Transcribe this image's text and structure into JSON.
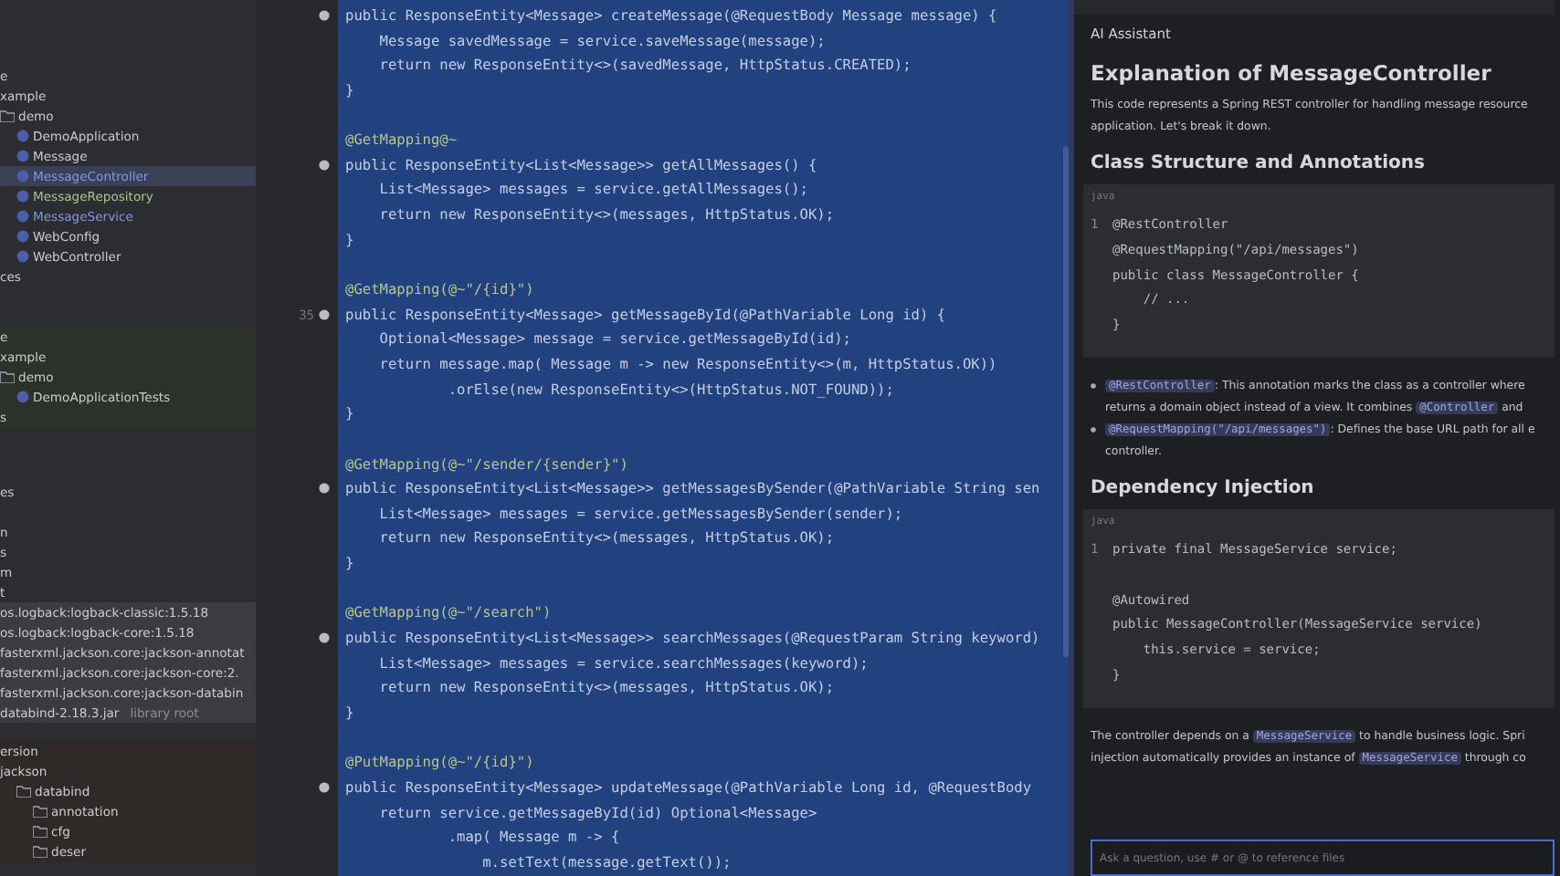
{
  "project_tree": {
    "sections": [
      {
        "kind": "main",
        "items": [
          {
            "label": "e"
          },
          {
            "label": "xample"
          },
          {
            "label": "demo",
            "kind": "folder",
            "children": [
              {
                "label": "DemoApplication",
                "kind": "class",
                "selected": false
              },
              {
                "label": "Message",
                "kind": "class",
                "selected": false
              },
              {
                "label": "MessageController",
                "kind": "class",
                "selected": true,
                "color": "#7f97e6"
              },
              {
                "label": "MessageRepository",
                "kind": "class",
                "selected": false,
                "color": "#a9c48f"
              },
              {
                "label": "MessageService",
                "kind": "class",
                "selected": false,
                "color": "#7f97e6"
              },
              {
                "label": "WebConfig",
                "kind": "class",
                "selected": false
              },
              {
                "label": "WebController",
                "kind": "class",
                "selected": false
              }
            ]
          },
          {
            "label": "ces"
          }
        ]
      },
      {
        "kind": "test",
        "items": [
          {
            "label": "e"
          },
          {
            "label": "xample"
          },
          {
            "label": "demo",
            "kind": "folder",
            "children": [
              {
                "label": "DemoApplicationTests",
                "kind": "class",
                "selected": false
              }
            ]
          },
          {
            "label": "s"
          }
        ]
      },
      {
        "kind": "other",
        "items": [
          {
            "label": "es"
          }
        ]
      },
      {
        "kind": "other",
        "items": [
          {
            "label": "n"
          },
          {
            "label": "s"
          },
          {
            "label": "m"
          },
          {
            "label": "t"
          }
        ]
      },
      {
        "kind": "libraries",
        "items": [
          {
            "label": "os.logback:logback-classic:1.5.18"
          },
          {
            "label": "os.logback:logback-core:1.5.18"
          },
          {
            "label": "fasterxml.jackson.core:jackson-annotat"
          },
          {
            "label": "fasterxml.jackson.core:jackson-core:2."
          },
          {
            "label": "fasterxml.jackson.core:jackson-databin"
          },
          {
            "label": "databind-2.18.3.jar",
            "hint": "library root"
          }
        ]
      },
      {
        "kind": "external",
        "items": [
          {
            "label": "ersion"
          },
          {
            "label": "jackson",
            "children": [
              {
                "label": "databind",
                "kind": "folder",
                "children": [
                  {
                    "label": "annotation",
                    "kind": "folder"
                  },
                  {
                    "label": "cfg",
                    "kind": "folder"
                  },
                  {
                    "label": "deser",
                    "kind": "folder"
                  }
                ]
              }
            ]
          }
        ]
      }
    ]
  },
  "gutter": {
    "line_number": "35"
  },
  "editor": {
    "lines": [
      {
        "kind": "code",
        "text": "public ResponseEntity<Message> createMessage(@RequestBody Message message) {",
        "bean": true
      },
      {
        "kind": "code",
        "text": "    Message savedMessage = service.saveMessage(message);"
      },
      {
        "kind": "code",
        "text": "    return new ResponseEntity<>(savedMessage, HttpStatus.CREATED);"
      },
      {
        "kind": "code",
        "text": "}"
      },
      {
        "kind": "blank"
      },
      {
        "kind": "annotation",
        "text": "@GetMapping@~"
      },
      {
        "kind": "code",
        "text": "public ResponseEntity<List<Message>> getAllMessages() {",
        "bean": true
      },
      {
        "kind": "code",
        "text": "    List<Message> messages = service.getAllMessages();"
      },
      {
        "kind": "code",
        "text": "    return new ResponseEntity<>(messages, HttpStatus.OK);"
      },
      {
        "kind": "code",
        "text": "}"
      },
      {
        "kind": "blank"
      },
      {
        "kind": "annotation",
        "text": "@GetMapping(@~\"/{id}\")"
      },
      {
        "kind": "code",
        "text": "public ResponseEntity<Message> getMessageById(@PathVariable Long id) {",
        "bean": true,
        "numbered": true
      },
      {
        "kind": "code",
        "text": "    Optional<Message> message = service.getMessageById(id);"
      },
      {
        "kind": "code",
        "text": "    return message.map( Message m -> new ResponseEntity<>(m, HttpStatus.OK))"
      },
      {
        "kind": "code",
        "text": "            .orElse(new ResponseEntity<>(HttpStatus.NOT_FOUND));"
      },
      {
        "kind": "code",
        "text": "}"
      },
      {
        "kind": "blank"
      },
      {
        "kind": "annotation",
        "text": "@GetMapping(@~\"/sender/{sender}\")"
      },
      {
        "kind": "code",
        "text": "public ResponseEntity<List<Message>> getMessagesBySender(@PathVariable String sen",
        "bean": true
      },
      {
        "kind": "code",
        "text": "    List<Message> messages = service.getMessagesBySender(sender);"
      },
      {
        "kind": "code",
        "text": "    return new ResponseEntity<>(messages, HttpStatus.OK);"
      },
      {
        "kind": "code",
        "text": "}"
      },
      {
        "kind": "blank"
      },
      {
        "kind": "annotation",
        "text": "@GetMapping(@~\"/search\")"
      },
      {
        "kind": "code",
        "text": "public ResponseEntity<List<Message>> searchMessages(@RequestParam String keyword)",
        "bean": true
      },
      {
        "kind": "code",
        "text": "    List<Message> messages = service.searchMessages(keyword);"
      },
      {
        "kind": "code",
        "text": "    return new ResponseEntity<>(messages, HttpStatus.OK);"
      },
      {
        "kind": "code",
        "text": "}"
      },
      {
        "kind": "blank"
      },
      {
        "kind": "annotation",
        "text": "@PutMapping(@~\"/{id}\")"
      },
      {
        "kind": "code",
        "text": "public ResponseEntity<Message> updateMessage(@PathVariable Long id, @RequestBody",
        "bean": true
      },
      {
        "kind": "code",
        "text": "    return service.getMessageById(id) Optional<Message>"
      },
      {
        "kind": "code",
        "text": "            .map( Message m -> {"
      },
      {
        "kind": "code",
        "text": "                m.setText(message.getText());"
      }
    ]
  },
  "assistant": {
    "title": "AI Assistant",
    "blocks": [
      {
        "kind": "h1",
        "text": "Explanation of MessageController"
      },
      {
        "kind": "p",
        "parts": [
          {
            "kind": "text",
            "text": "This code represents a Spring REST controller for handling message resource"
          }
        ]
      },
      {
        "kind": "p",
        "parts": [
          {
            "kind": "text",
            "text": "application. Let's break it down."
          }
        ]
      },
      {
        "kind": "h2",
        "text": "Class Structure and Annotations"
      },
      {
        "kind": "code",
        "lang": "java",
        "lines": [
          {
            "kind": "code",
            "num": "1",
            "text": "@RestController"
          },
          {
            "kind": "code",
            "text": "@RequestMapping(\"/api/messages\")"
          },
          {
            "kind": "code",
            "text": "public class MessageController {"
          },
          {
            "kind": "code",
            "text": "    // ..."
          },
          {
            "kind": "code",
            "text": "}"
          }
        ]
      },
      {
        "kind": "bullet",
        "parts": [
          {
            "kind": "code",
            "text": "@RestController"
          },
          {
            "kind": "text",
            "text": ": This annotation marks the class as a controller where"
          }
        ],
        "cont": [
          {
            "kind": "text",
            "text": "returns a domain object instead of a view. It combines "
          },
          {
            "kind": "code",
            "text": "@Controller"
          },
          {
            "kind": "text",
            "text": " and"
          }
        ]
      },
      {
        "kind": "bullet",
        "parts": [
          {
            "kind": "code",
            "text": "@RequestMapping(\"/api/messages\")"
          },
          {
            "kind": "text",
            "text": ": Defines the base URL path for all e"
          }
        ],
        "cont": [
          {
            "kind": "text",
            "text": "controller."
          }
        ]
      },
      {
        "kind": "h2",
        "text": "Dependency Injection"
      },
      {
        "kind": "code",
        "lang": "java",
        "lines": [
          {
            "kind": "code",
            "num": "1",
            "text": "private final MessageService service;"
          },
          {
            "kind": "blank"
          },
          {
            "kind": "code",
            "text": "@Autowired"
          },
          {
            "kind": "code",
            "text": "public MessageController(MessageService service)"
          },
          {
            "kind": "code",
            "text": "    this.service = service;"
          },
          {
            "kind": "code",
            "text": "}"
          }
        ]
      },
      {
        "kind": "p",
        "parts": [
          {
            "kind": "text",
            "text": "The controller depends on a "
          },
          {
            "kind": "code",
            "text": "MessageService"
          },
          {
            "kind": "text",
            "text": " to handle business logic. Spri"
          }
        ]
      },
      {
        "kind": "p",
        "parts": [
          {
            "kind": "text",
            "text": "injection automatically provides an instance of "
          },
          {
            "kind": "code",
            "text": "MessageService"
          },
          {
            "kind": "text",
            "text": " through co"
          }
        ]
      }
    ],
    "input": {
      "placeholder": "Ask a question, use # or @ to reference files"
    }
  }
}
